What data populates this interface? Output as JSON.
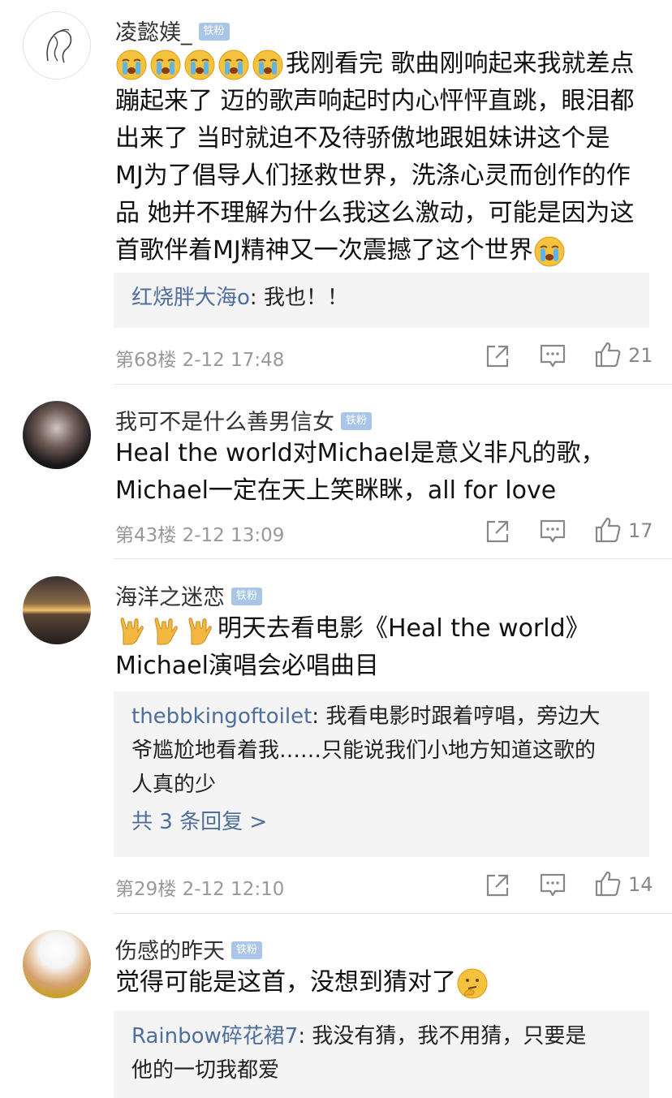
{
  "comments": [
    {
      "username": "凌懿媄_",
      "badge": "铁粉",
      "body_lines": [
        "我刚看完 歌曲刚响起来我就差点",
        "蹦起来了 迈的歌声响起时内心怦怦直跳，眼泪都",
        "出来了 当时就迫不及待骄傲地跟姐妹讲这个是",
        "MJ为了倡导人们拯救世界，洗涤心灵而创作的作",
        "品 她并不理解为什么我这么激动，可能是因为这",
        "首歌伴着MJ精神又一次震撼了这个世界"
      ],
      "reply_user": "红烧胖大海o",
      "reply_text": ": 我也！！",
      "floor": "第68楼",
      "time": "2-12 17:48",
      "likes": "21"
    },
    {
      "username": "我可不是什么善男信女",
      "badge": "铁粉",
      "body_lines": [
        "Heal the world对Michael是意义非凡的歌，",
        "Michael一定在天上笑眯眯，all for love"
      ],
      "floor": "第43楼",
      "time": "2-12 13:09",
      "likes": "17"
    },
    {
      "username": "海洋之迷恋",
      "badge": "铁粉",
      "body_lines": [
        "明天去看电影《Heal the world》",
        "Michael演唱会必唱曲目"
      ],
      "reply_user": "thebbkingoftoilet",
      "reply_lines": [
        ": 我看电影时跟着哼唱，旁边大",
        "爷尴尬地看着我……只能说我们小地方知道这歌的",
        "人真的少"
      ],
      "more_replies": "共 3 条回复 >",
      "floor": "第29楼",
      "time": "2-12 12:10",
      "likes": "14"
    },
    {
      "username": "伤感的昨天",
      "badge": "铁粉",
      "body_lines": [
        "觉得可能是这首，没想到猜对了"
      ],
      "reply_user": "Rainbow碎花裙7",
      "reply_lines": [
        ": 我没有猜，我不用猜，只要是",
        "他的一切我都爱"
      ]
    }
  ],
  "icons": {
    "crying_emoji": "crying-emoji-icon",
    "rock_hand_emoji": "rock-hand-emoji-icon",
    "thinking_emoji": "thinking-emoji-icon",
    "share": "share-icon",
    "reply": "reply-icon",
    "like": "thumbs-up-icon"
  },
  "colors": {
    "link": "#4e6e9c",
    "badge": "#a9c6e8",
    "meta": "#999999",
    "reply_bg": "#f4f4f4"
  }
}
